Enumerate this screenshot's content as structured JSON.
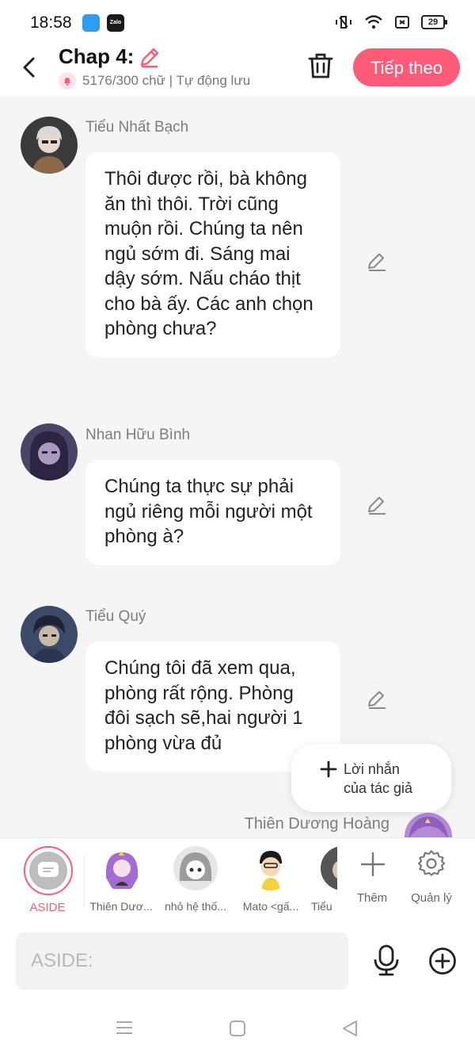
{
  "status_bar": {
    "time": "18:58",
    "app_icon_2": "Zalo",
    "battery": "29"
  },
  "header": {
    "title": "Chap 4:",
    "subtitle": "5176/300 chữ | Tự động lưu",
    "next_button": "Tiếp theo"
  },
  "messages": [
    {
      "sender": "Tiểu Nhất Bạch",
      "text": "Thôi được rồi, bà không ăn thì thôi. Trời cũng muộn rồi. Chúng ta nên ngủ sớm đi. Sáng mai dậy sớm. Nấu cháo thịt cho bà ấy. Các anh chọn phòng chưa?"
    },
    {
      "sender": "Nhan Hữu Bình",
      "text": "Chúng ta thực sự phải ngủ riêng mỗi người một phòng à?"
    },
    {
      "sender": "Tiểu Quý",
      "text": "Chúng tôi đã xem qua, phòng rất rộng. Phòng đôi sạch sẽ,hai người 1 phòng vừa đủ"
    },
    {
      "sender": "Thiên Dương Hoàng"
    }
  ],
  "author_note": {
    "line1": "Lời nhắn",
    "line2": "của tác giả"
  },
  "characters": {
    "aside": "ASIDE",
    "list": [
      "Thiên Dươ...",
      "nhỏ hệ thố...",
      "Mato <gấ...",
      "Tiểu"
    ],
    "more": "Thêm",
    "manage": "Quản lý"
  },
  "input": {
    "placeholder": "ASIDE:"
  },
  "colors": {
    "accent": "#ff5a78",
    "bubble": "#ffffff",
    "background": "#f5f5f5"
  }
}
